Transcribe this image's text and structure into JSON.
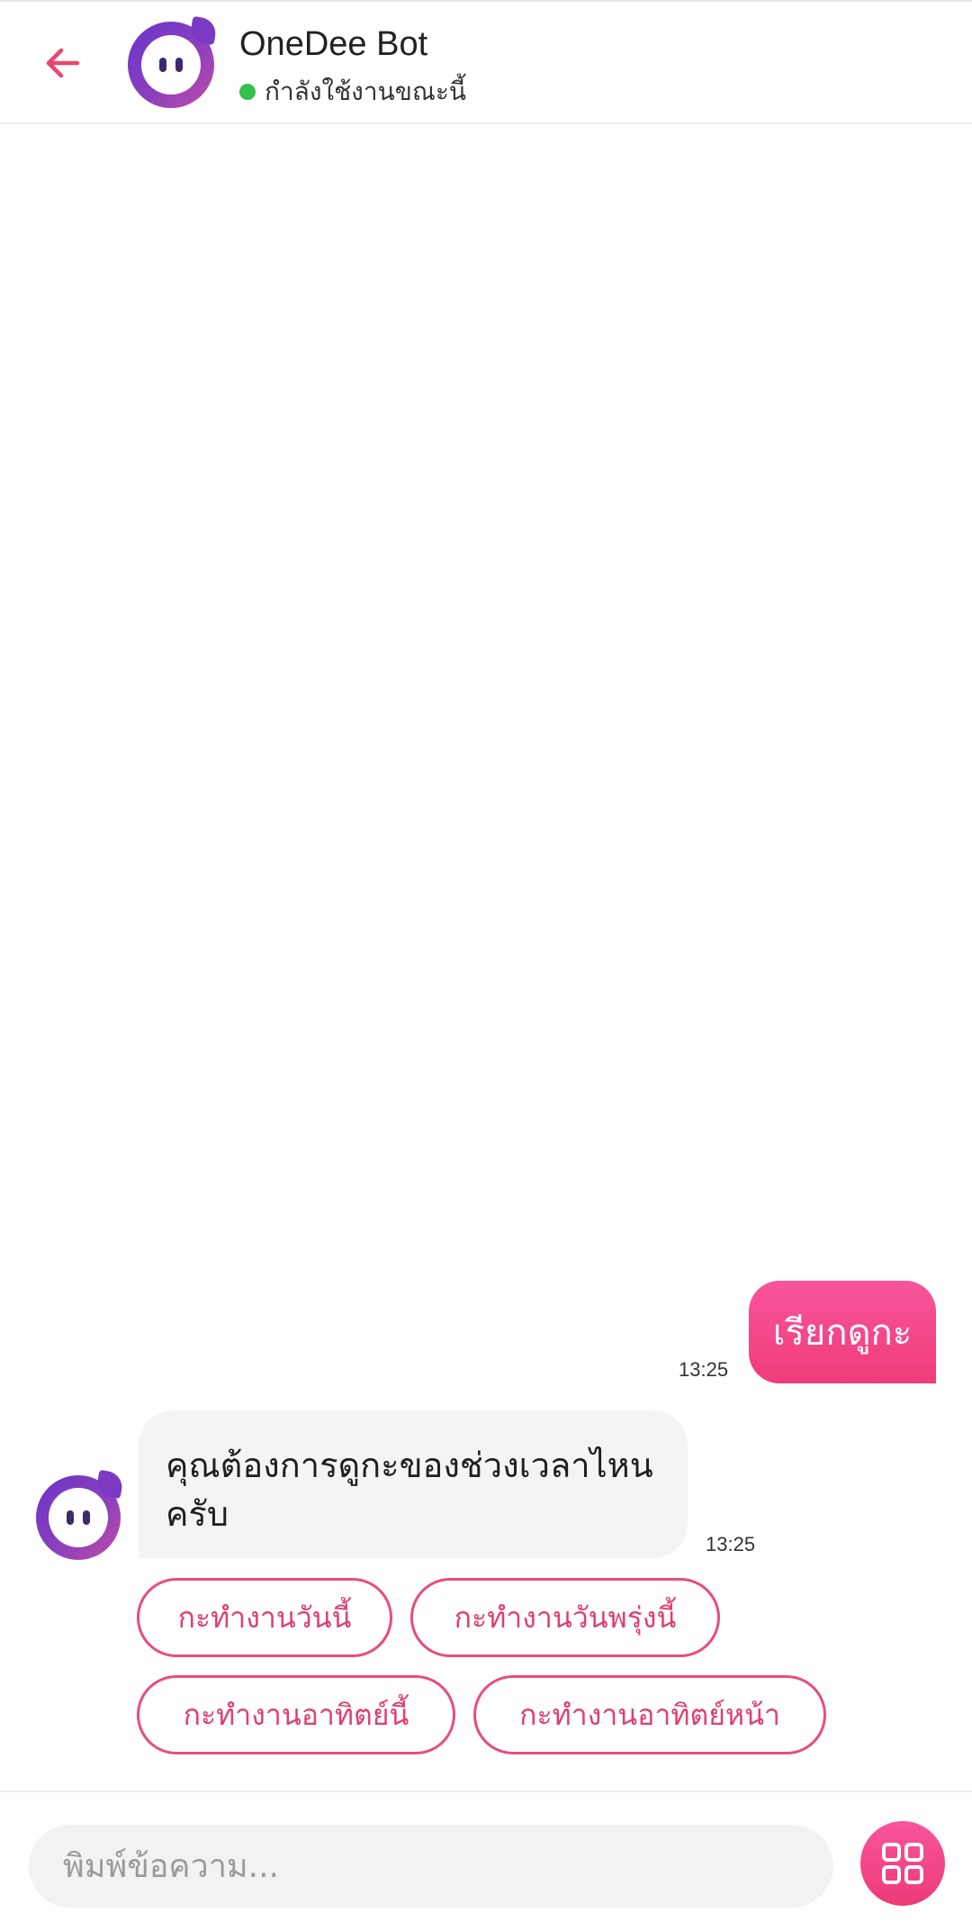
{
  "header": {
    "bot_name": "OneDee Bot",
    "status": "กำลังใช้งานขณะนี้"
  },
  "messages": {
    "user_text": "เรียกดูกะ",
    "user_time": "13:25",
    "bot_text": "คุณต้องการดูกะของช่วงเวลาไหนครับ",
    "bot_time": "13:25"
  },
  "quick_replies": [
    "กะทำงานวันนี้",
    "กะทำงานวันพรุ่งนี้",
    "กะทำงานอาทิตย์นี้",
    "กะทำงานอาทิตย์หน้า"
  ],
  "composer": {
    "placeholder": "พิมพ์ข้อความ..."
  },
  "colors": {
    "accent": "#f03c7a",
    "online": "#35c04e",
    "avatar": "#7a3ac4"
  },
  "icons": {
    "back": "arrow-left-icon",
    "menu": "grid-icon"
  }
}
